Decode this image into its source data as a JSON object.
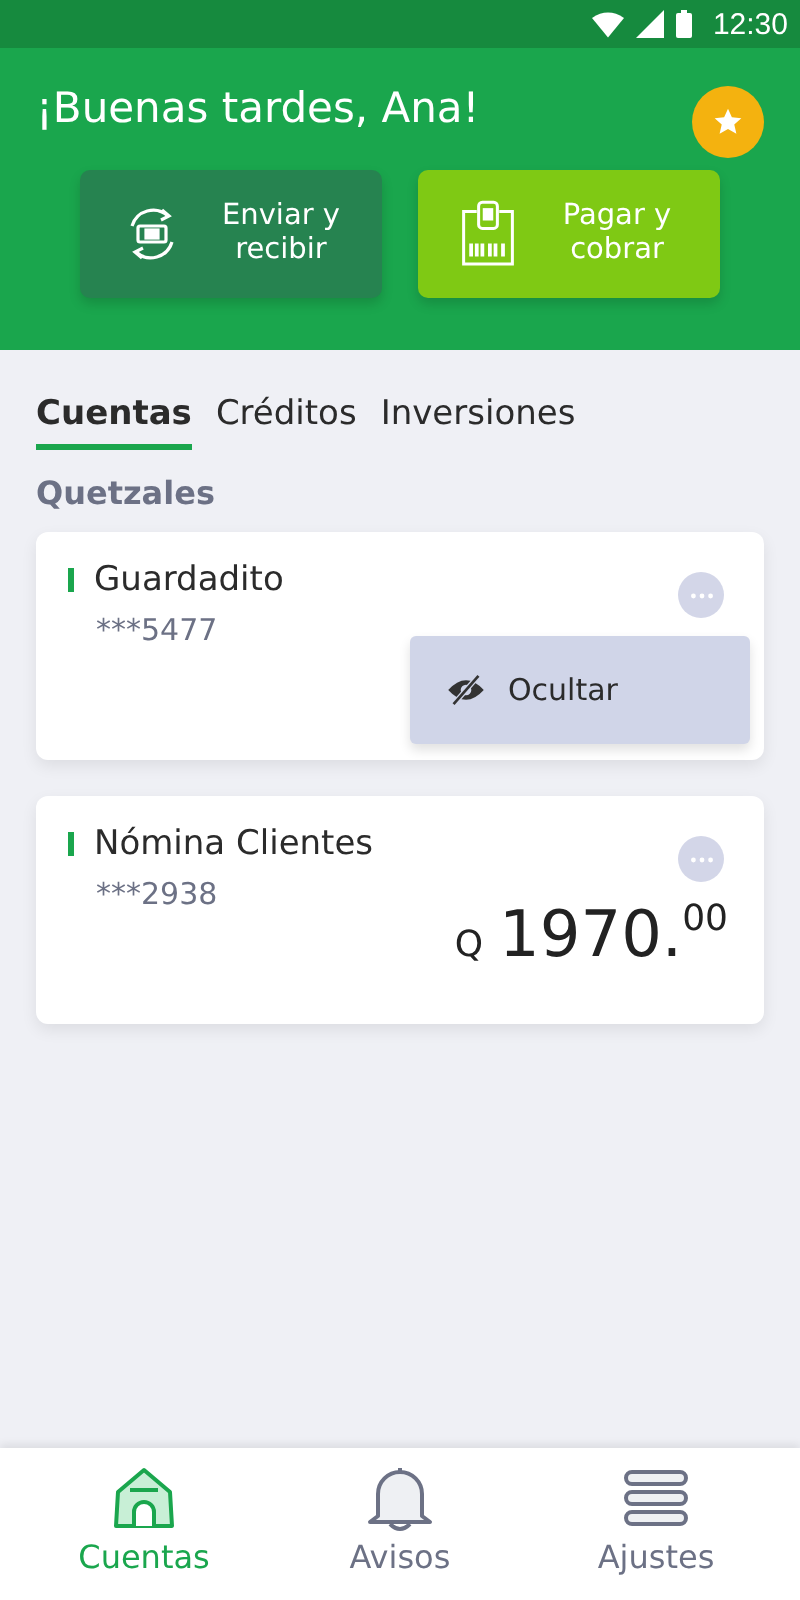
{
  "status_bar": {
    "time": "12:30"
  },
  "header": {
    "greeting": "¡Buenas tardes, Ana!",
    "actions": [
      {
        "kind": "transfer",
        "label": "Enviar y recibir"
      },
      {
        "kind": "pay",
        "label": "Pagar y cobrar"
      }
    ]
  },
  "tabs": [
    {
      "label": "Cuentas",
      "selected": true
    },
    {
      "label": "Créditos",
      "selected": false
    },
    {
      "label": "Inversiones",
      "selected": false
    }
  ],
  "section": "Quetzales",
  "accounts": [
    {
      "name": "Guardadito",
      "number": "***5477",
      "menu": [
        {
          "label": "Ocultar"
        }
      ]
    },
    {
      "name": "Nómina Clientes",
      "number": "***2938",
      "currency": "Q",
      "balance": "1970.$^{00}$"
    }
  ],
  "nav": [
    {
      "kind": "home",
      "label": "Cuentas",
      "selected": true
    },
    {
      "kind": "bell",
      "label": "Avisos",
      "selected": false
    },
    {
      "kind": "menu",
      "label": "Ajustes",
      "selected": false
    }
  ]
}
